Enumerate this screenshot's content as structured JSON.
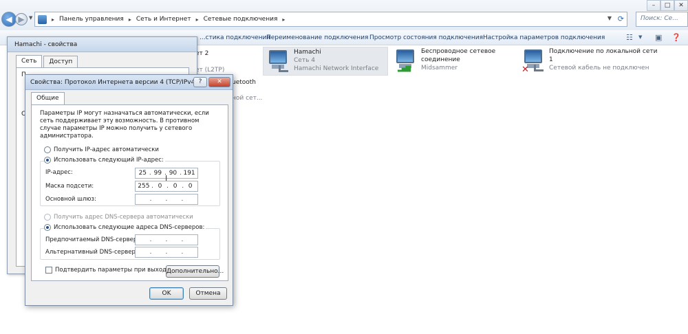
{
  "window": {
    "search_placeholder": "Поиск: Се...",
    "minimize": "–",
    "maximize": "□",
    "close": "✕"
  },
  "breadcrumbs": [
    "Панель управления",
    "Сеть и Интернет",
    "Сетевые подключения"
  ],
  "toolbar": {
    "items": [
      "...стика подключения",
      "Переименование подключения",
      "Просмотр состояния подключения",
      "Настройка параметров подключения"
    ]
  },
  "connections": [
    {
      "name": "Hamachi",
      "line2": "Сеть  4",
      "line3": "Hamachi Network Interface"
    },
    {
      "name": "Беспроводное сетевое",
      "line2": "соединение",
      "line3": "Midsammer"
    },
    {
      "name": "Подключение по локальной сети",
      "line2": "1",
      "line3": "Сетевой кабель не подключен"
    }
  ],
  "partials": {
    "p1": "ет 2",
    "p2": "ет (L2TP)",
    "p3": "uetooth",
    "p4": "ной сет..."
  },
  "hamachi_dialog": {
    "title": "Hamachi - свойства",
    "tab_network": "Сеть",
    "tab_access": "Доступ",
    "edge1": "П",
    "edge2": "С"
  },
  "ipv4_dialog": {
    "title": "Свойства: Протокол Интернета версии 4 (TCP/IPv4)",
    "help": "?",
    "close": "✕",
    "tab_general": "Общие",
    "description": "Параметры IP могут назначаться автоматически, если сеть поддерживает эту возможность. В противном случае параметры IP можно получить у сетевого администратора.",
    "radio_auto_ip": "Получить IP-адрес автоматически",
    "radio_manual_ip": "Использовать следующий IP-адрес:",
    "label_ip": "IP-адрес:",
    "label_mask": "Маска подсети:",
    "label_gateway": "Основной шлюз:",
    "ip_address": [
      "25",
      "99",
      "90",
      "191"
    ],
    "subnet_mask": [
      "255",
      "0",
      "0",
      "0"
    ],
    "gateway": [
      "",
      "",
      "",
      ""
    ],
    "radio_auto_dns": "Получить адрес DNS-сервера автоматически",
    "radio_manual_dns": "Использовать следующие адреса DNS-серверов:",
    "label_pref_dns": "Предпочитаемый DNS-сервер:",
    "label_alt_dns": "Альтернативный DNS-сервер:",
    "pref_dns": [
      "",
      "",
      "",
      ""
    ],
    "alt_dns": [
      "",
      "",
      "",
      ""
    ],
    "checkbox_validate": "Подтвердить параметры при выходе",
    "advanced_button": "Дополнительно...",
    "ok_button": "OK",
    "cancel_button": "Отмена",
    "dot": "."
  }
}
